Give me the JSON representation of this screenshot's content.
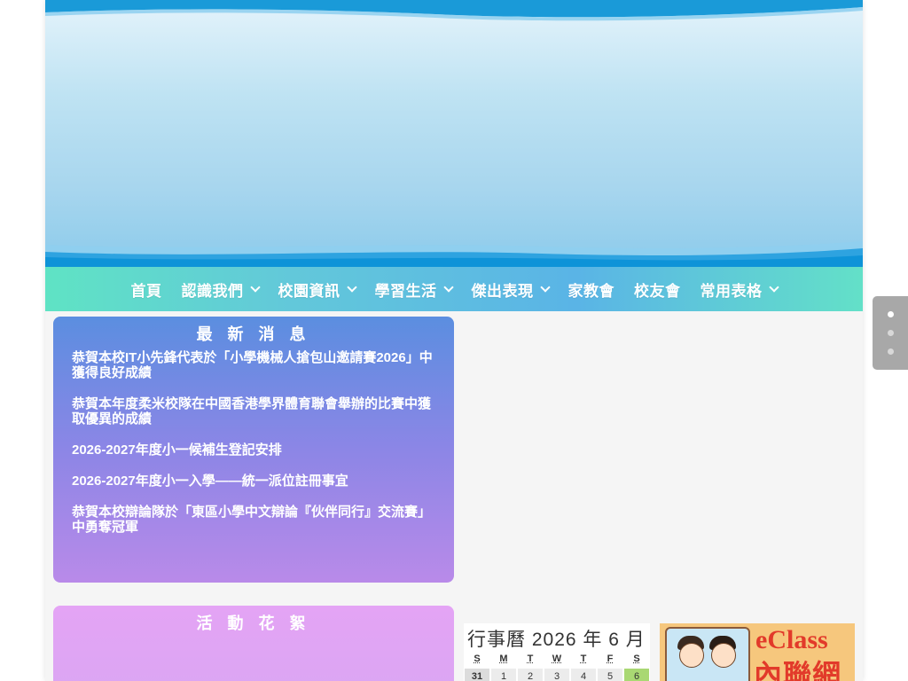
{
  "nav": {
    "items": [
      {
        "label": "首頁",
        "has_dropdown": false
      },
      {
        "label": "認識我們",
        "has_dropdown": true
      },
      {
        "label": "校園資訊",
        "has_dropdown": true
      },
      {
        "label": "學習生活",
        "has_dropdown": true
      },
      {
        "label": "傑出表現",
        "has_dropdown": true
      },
      {
        "label": "家教會",
        "has_dropdown": false
      },
      {
        "label": "校友會",
        "has_dropdown": false
      },
      {
        "label": "常用表格",
        "has_dropdown": true
      }
    ]
  },
  "news": {
    "title": "最 新 消 息",
    "items": [
      "恭賀本校IT小先鋒代表於「小學機械人搶包山邀請賽2026」中獲得良好成績",
      "恭賀本年度柔米校隊在中國香港學界體育聯會舉辦的比賽中獲取優異的成績",
      "2026-2027年度小一候補生登記安排",
      "2026-2027年度小一入學——統一派位註冊事宜",
      "恭賀本校辯論隊於「東區小學中文辯論『伙伴同行』交流賽」中勇奪冠軍"
    ]
  },
  "activity": {
    "title": "活 動 花 絮"
  },
  "calendar": {
    "title": "行事曆 2026 年 6 月",
    "weekdays": [
      "S",
      "M",
      "T",
      "W",
      "T",
      "F",
      "S"
    ],
    "first_row": [
      "31",
      "1",
      "2",
      "3",
      "4",
      "5",
      "6"
    ]
  },
  "eclass": {
    "text1": "eClass",
    "text2": "內聯網"
  },
  "slider": {
    "count": 3,
    "active": 0
  },
  "colors": {
    "nav_gradient_start": "#5fe3c4",
    "nav_gradient_end": "#5ab4e6",
    "news_top": "#5b8ee0",
    "news_bottom": "#b98ae9",
    "activity": "#e4a4f5",
    "calendar_highlight": "#a9d873",
    "eclass_red": "#e23a2a"
  }
}
